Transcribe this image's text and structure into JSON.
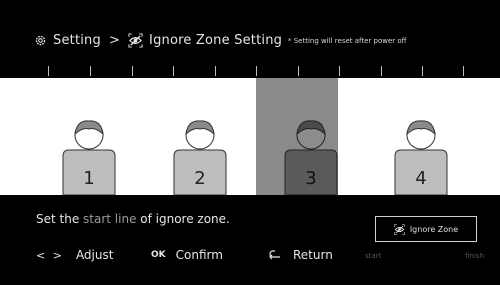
{
  "header": {
    "setting_label": "Setting",
    "separator": ">",
    "current_label": "Ignore Zone Setting",
    "note": "* Setting will reset after power off",
    "icons": [
      "gear-icon",
      "eye-slash-icon"
    ]
  },
  "persons": [
    {
      "label": "1",
      "active": false
    },
    {
      "label": "2",
      "active": false
    },
    {
      "label": "3",
      "active": true
    },
    {
      "label": "4",
      "active": false
    }
  ],
  "instruction": {
    "before": "Set the ",
    "highlight": "start line",
    "after": " of ignore zone."
  },
  "controls": {
    "adjust_key": "< >",
    "adjust_label": "Adjust",
    "confirm_key": "OK",
    "confirm_label": "Confirm",
    "return_label": "Return"
  },
  "ignore_zone_button": {
    "label": "Ignore Zone"
  },
  "range_labels": {
    "start": "start",
    "finish": "finish"
  },
  "colors": {
    "background": "#000000",
    "stage": "#ffffff",
    "selected_band": "#8a8a8a",
    "highlight_text": "#9a9a9a"
  }
}
